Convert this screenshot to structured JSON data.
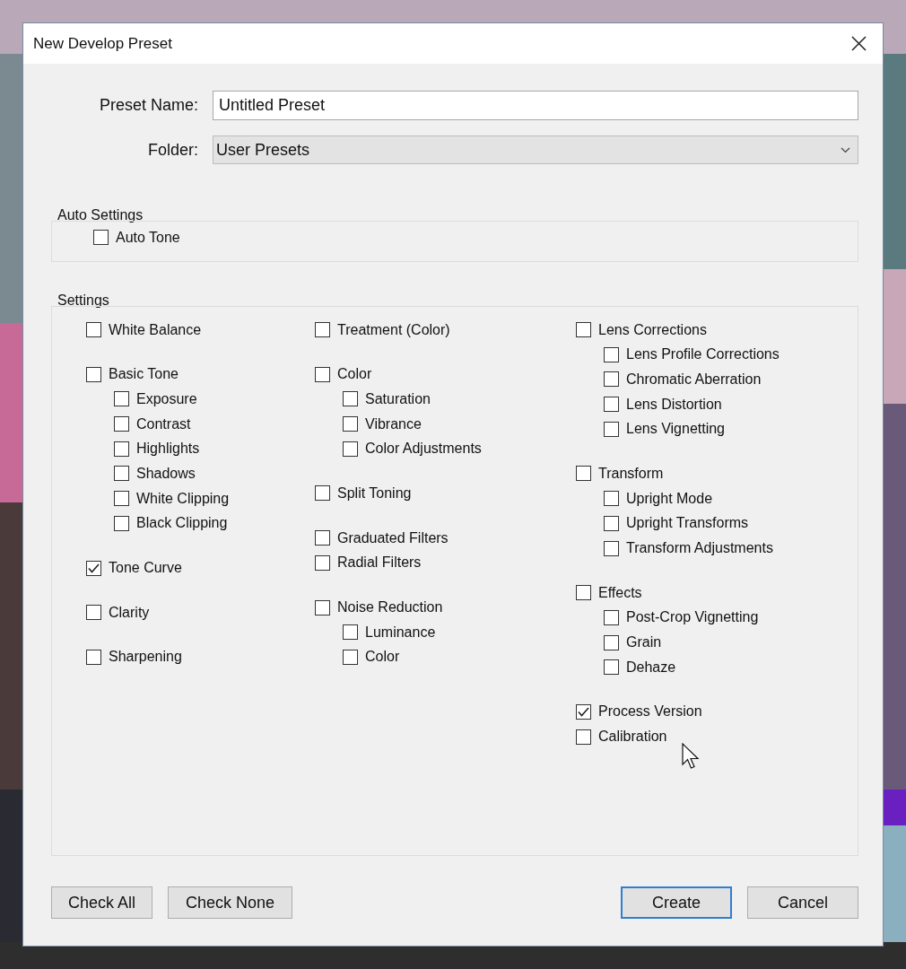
{
  "window": {
    "title": "New Develop Preset"
  },
  "preset_name": {
    "label": "Preset Name:",
    "value": "Untitled Preset"
  },
  "folder": {
    "label": "Folder:",
    "value": "User Presets"
  },
  "auto_settings": {
    "title": "Auto Settings",
    "items": [
      {
        "label": "Auto Tone",
        "checked": false
      }
    ]
  },
  "settings": {
    "title": "Settings",
    "columns": [
      [
        [
          {
            "label": "White Balance",
            "checked": false
          }
        ],
        [
          {
            "label": "Basic Tone",
            "checked": false,
            "children": [
              {
                "label": "Exposure",
                "checked": false
              },
              {
                "label": "Contrast",
                "checked": false
              },
              {
                "label": "Highlights",
                "checked": false
              },
              {
                "label": "Shadows",
                "checked": false
              },
              {
                "label": "White Clipping",
                "checked": false
              },
              {
                "label": "Black Clipping",
                "checked": false
              }
            ]
          }
        ],
        [
          {
            "label": "Tone Curve",
            "checked": true
          }
        ],
        [
          {
            "label": "Clarity",
            "checked": false
          }
        ],
        [
          {
            "label": "Sharpening",
            "checked": false
          }
        ]
      ],
      [
        [
          {
            "label": "Treatment (Color)",
            "checked": false
          }
        ],
        [
          {
            "label": "Color",
            "checked": false,
            "children": [
              {
                "label": "Saturation",
                "checked": false
              },
              {
                "label": "Vibrance",
                "checked": false
              },
              {
                "label": "Color Adjustments",
                "checked": false
              }
            ]
          }
        ],
        [
          {
            "label": "Split Toning",
            "checked": false
          }
        ],
        [
          {
            "label": "Graduated Filters",
            "checked": false
          },
          {
            "label": "Radial Filters",
            "checked": false
          }
        ],
        [
          {
            "label": "Noise Reduction",
            "checked": false,
            "children": [
              {
                "label": "Luminance",
                "checked": false
              },
              {
                "label": "Color",
                "checked": false
              }
            ]
          }
        ]
      ],
      [
        [
          {
            "label": "Lens Corrections",
            "checked": false,
            "children": [
              {
                "label": "Lens Profile Corrections",
                "checked": false
              },
              {
                "label": "Chromatic Aberration",
                "checked": false
              },
              {
                "label": "Lens Distortion",
                "checked": false
              },
              {
                "label": "Lens Vignetting",
                "checked": false
              }
            ]
          }
        ],
        [
          {
            "label": "Transform",
            "checked": false,
            "children": [
              {
                "label": "Upright Mode",
                "checked": false
              },
              {
                "label": "Upright Transforms",
                "checked": false
              },
              {
                "label": "Transform Adjustments",
                "checked": false
              }
            ]
          }
        ],
        [
          {
            "label": "Effects",
            "checked": false,
            "children": [
              {
                "label": "Post-Crop Vignetting",
                "checked": false
              },
              {
                "label": "Grain",
                "checked": false
              },
              {
                "label": "Dehaze",
                "checked": false
              }
            ]
          }
        ],
        [
          {
            "label": "Process Version",
            "checked": true
          },
          {
            "label": "Calibration",
            "checked": false
          }
        ]
      ]
    ]
  },
  "left_buttons": [
    {
      "label": "Check All",
      "default": false
    },
    {
      "label": "Check None",
      "default": false
    }
  ],
  "right_buttons": [
    {
      "label": "Create",
      "default": true
    },
    {
      "label": "Cancel",
      "default": false
    }
  ]
}
